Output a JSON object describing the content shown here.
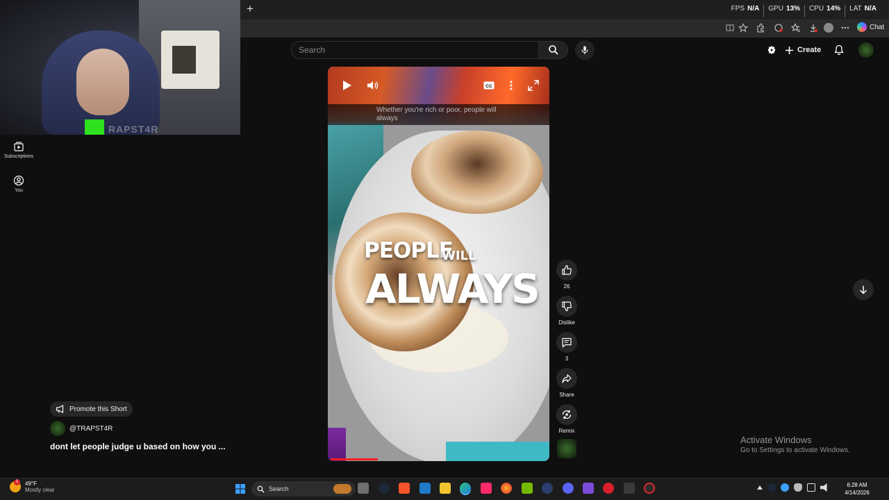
{
  "webcam": {
    "tag": "RAPST4R"
  },
  "overlay": {
    "fps_label": "FPS",
    "fps_value": "N/A",
    "gpu_label": "GPU",
    "gpu_value": "13%",
    "cpu_label": "CPU",
    "cpu_value": "14%",
    "lat_label": "LAT",
    "lat_value": "N/A"
  },
  "browser": {
    "chat_label": "Chat"
  },
  "header": {
    "search_placeholder": "Search",
    "create_label": "Create"
  },
  "sidebar": {
    "items": [
      {
        "label": "Subscriptions",
        "icon": "subscriptions-icon"
      },
      {
        "label": "You",
        "icon": "user-circle-icon"
      }
    ]
  },
  "short": {
    "caption": "Whether you're rich or poor, people will always",
    "overlay_line1": "PEOPLE",
    "overlay_line1b": "WILL",
    "overlay_line2": "ALWAYS",
    "progress_fraction": 0.22,
    "actions": {
      "like_count": "26",
      "dislike_label": "Dislike",
      "comment_count": "3",
      "share_label": "Share",
      "remix_label": "Remix"
    },
    "promote_label": "Promote this Short",
    "channel": "@TRAPST4R",
    "title": "dont let people judge u based on how you ..."
  },
  "watermark": {
    "line1": "Activate Windows",
    "line2": "Go to Settings to activate Windows."
  },
  "taskbar": {
    "weather_temp": "49°F",
    "weather_desc": "Mostly clear",
    "weather_badge": "1",
    "search_label": "Search",
    "time": "6:28 AM",
    "date": "4/14/2026"
  },
  "colors": {
    "accent_red": "#ff1e1e",
    "kick_green": "#2fe01e",
    "background": "#0f0f0f"
  }
}
